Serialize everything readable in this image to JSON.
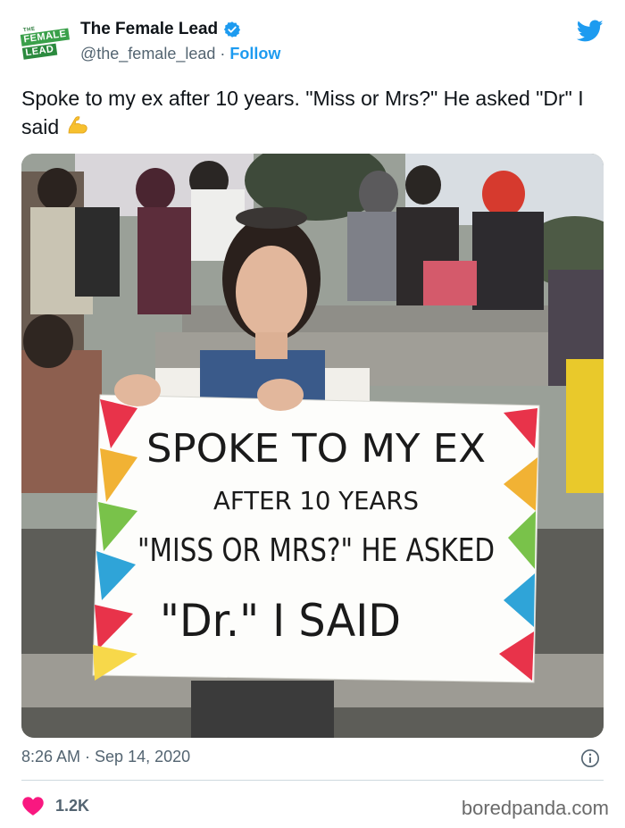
{
  "header": {
    "avatar_text_top": "THE",
    "avatar_text_1": "FEMALE",
    "avatar_text_2": "LEAD",
    "display_name": "The Female Lead",
    "handle": "@the_female_lead",
    "separator": " · ",
    "follow_label": "Follow"
  },
  "tweet": {
    "text": "Spoke to my ex after 10 years. \"Miss or Mrs?\" He asked \"Dr\" I said",
    "emoji": "flexed-biceps"
  },
  "photo": {
    "sign_lines": [
      "SPOKE TO MY EX",
      "AFTER 10 YEARS",
      "\"MISS OR MRS?\" HE ASKED",
      "\"Dr.\" I SAID"
    ]
  },
  "footer": {
    "timestamp": "8:26 AM · Sep 14, 2020",
    "like_count": "1.2K",
    "watermark": "boredpanda.com"
  },
  "colors": {
    "twitter_blue": "#1d9bf0",
    "like_red": "#f91880",
    "brand_green": "#2b8a3e"
  }
}
